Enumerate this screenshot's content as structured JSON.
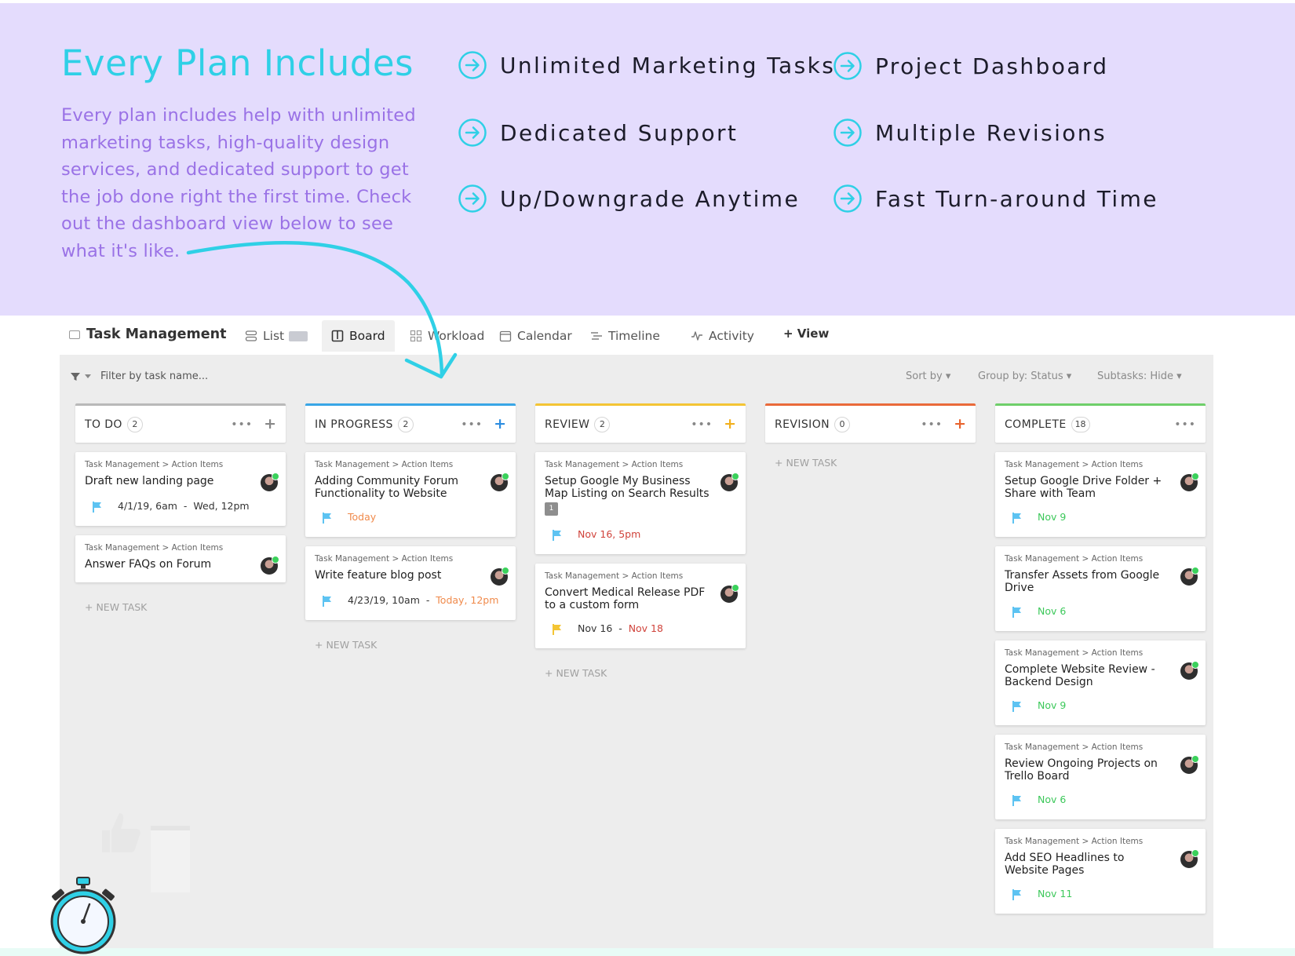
{
  "hero": {
    "title": "Every Plan Includes",
    "body": "Every plan includes help with unlimited marketing tasks, high-quality design services, and dedicated support to get the job done right the first time. Check out the dashboard view below to see what it's like.",
    "features": [
      "Unlimited Marketing Tasks",
      "Project Dashboard",
      "Dedicated Support",
      "Multiple Revisions",
      "Up/Downgrade Anytime",
      "Fast Turn-around Time"
    ]
  },
  "app": {
    "title": "Task Management",
    "views": [
      "List",
      "Board",
      "Workload",
      "Calendar",
      "Timeline",
      "Activity"
    ],
    "add_view": "+ View",
    "active_view": "Board"
  },
  "toolbar": {
    "filter_placeholder": "Filter by task name...",
    "sort": "Sort by",
    "group": "Group by: Status",
    "subtasks": "Subtasks: Hide"
  },
  "board": {
    "new_task_label": "+ NEW TASK",
    "columns": [
      {
        "name": "TO DO",
        "count": "2",
        "color": "#b9b9b9",
        "plus_color": "#888888",
        "cards": [
          {
            "crumb": "Task Management  > Action Items",
            "title": "Draft new landing page",
            "date_start": "4/1/19, 6am",
            "date_end": "Wed, 12pm",
            "flag": "#5dc3f2"
          },
          {
            "crumb": "Task Management  > Action Items",
            "title": "Answer FAQs on Forum"
          }
        ]
      },
      {
        "name": "IN PROGRESS",
        "count": "2",
        "color": "#39a6e6",
        "plus_color": "#2d8de0",
        "cards": [
          {
            "crumb": "Task Management  > Action Items",
            "title": "Adding Community Forum Functionality to Website",
            "date_end": "Today",
            "flag": "#5dc3f2"
          },
          {
            "crumb": "Task Management  > Action Items",
            "title": "Write feature blog post",
            "date_start": "4/23/19, 10am",
            "date_end": "Today, 12pm",
            "flag": "#5dc3f2"
          }
        ]
      },
      {
        "name": "REVIEW",
        "count": "2",
        "color": "#f4c534",
        "plus_color": "#f2b01e",
        "cards": [
          {
            "crumb": "Task Management  > Action Items",
            "title": "Setup Google My Business Map Listing on Search Results",
            "badge": "1",
            "date_end": "Nov 16, 5pm",
            "flag": "#5dc3f2"
          },
          {
            "crumb": "Task Management  > Action Items",
            "title": "Convert Medical Release PDF to a custom form",
            "date_start": "Nov 16",
            "date_end": "Nov 18",
            "flag": "#f4c534"
          }
        ]
      },
      {
        "name": "REVISION",
        "count": "0",
        "color": "#ea6a3a",
        "plus_color": "#e8642f",
        "cards": []
      },
      {
        "name": "COMPLETE",
        "count": "18",
        "color": "#6fcf6a",
        "plus_color": "",
        "cards": [
          {
            "crumb": "Task Management  > Action Items",
            "title": "Setup Google Drive Folder + Share with Team",
            "date_end": "Nov 9",
            "flag": "#5dc3f2"
          },
          {
            "crumb": "Task Management  > Action Items",
            "title": "Transfer Assets from Google Drive",
            "date_end": "Nov 6",
            "flag": "#5dc3f2"
          },
          {
            "crumb": "Task Management  > Action Items",
            "title": "Complete Website Review - Backend Design",
            "date_end": "Nov 9",
            "flag": "#5dc3f2"
          },
          {
            "crumb": "Task Management  > Action Items",
            "title": "Review Ongoing Projects on Trello Board",
            "date_end": "Nov 6",
            "flag": "#5dc3f2"
          },
          {
            "crumb": "Task Management  > Action Items",
            "title": "Add SEO Headlines to Website Pages",
            "date_end": "Nov 11",
            "flag": "#5dc3f2"
          }
        ]
      }
    ]
  },
  "colors": {
    "hero_bg": "#e4dcfd",
    "accent_cyan": "#2fd0e6",
    "body_purple": "#9a72e6",
    "date_red": "#d0433b",
    "date_orange": "#f08a4b",
    "date_green": "#3cc85a"
  },
  "icons": {
    "feature": "arrow-circle-right-icon",
    "decor_bottom_left": "stopwatch-icon",
    "decor_arrow": "curved-arrow-icon"
  }
}
